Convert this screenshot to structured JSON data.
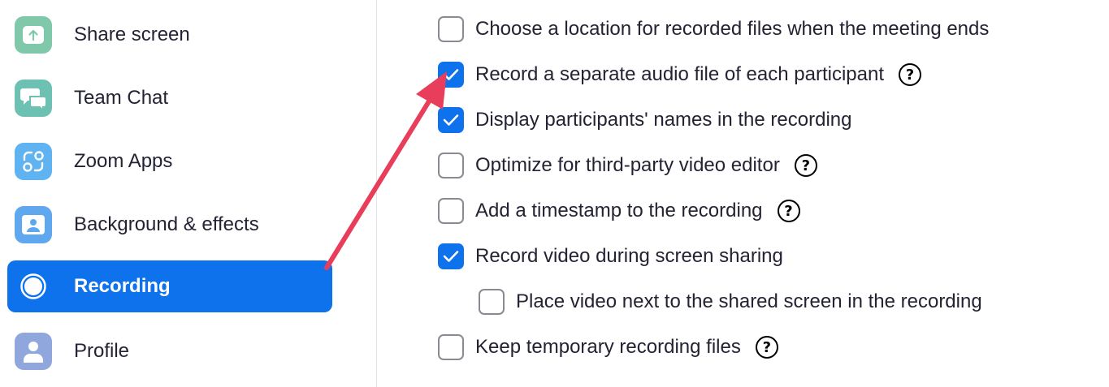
{
  "sidebar": {
    "items": [
      {
        "label": "Share screen",
        "icon": "share-screen-icon",
        "color": "#7fc8a9"
      },
      {
        "label": "Team Chat",
        "icon": "chat-icon",
        "color": "#6cc1b3"
      },
      {
        "label": "Zoom Apps",
        "icon": "apps-icon",
        "color": "#5fb3f0"
      },
      {
        "label": "Background & effects",
        "icon": "background-icon",
        "color": "#5fa8f0"
      },
      {
        "label": "Recording",
        "icon": "record-icon",
        "active": true
      },
      {
        "label": "Profile",
        "icon": "profile-icon",
        "color": "#8fa7dc"
      }
    ],
    "active_color": "#0e72ed"
  },
  "options": [
    {
      "label": "Choose a location for recorded files when the meeting ends",
      "checked": false,
      "help": false
    },
    {
      "label": "Record a separate audio file of each participant",
      "checked": true,
      "help": true
    },
    {
      "label": "Display participants' names in the recording",
      "checked": true,
      "help": false
    },
    {
      "label": "Optimize for third-party video editor",
      "checked": false,
      "help": true
    },
    {
      "label": "Add a timestamp to the recording",
      "checked": false,
      "help": true
    },
    {
      "label": "Record video during screen sharing",
      "checked": true,
      "help": false
    },
    {
      "label": "Place video next to the shared screen in the recording",
      "checked": false,
      "help": false,
      "indent": true
    },
    {
      "label": "Keep temporary recording files",
      "checked": false,
      "help": true
    }
  ],
  "help_glyph": "?",
  "annotation": {
    "color": "#e83e5c",
    "icon": "red-arrow-annotation"
  }
}
